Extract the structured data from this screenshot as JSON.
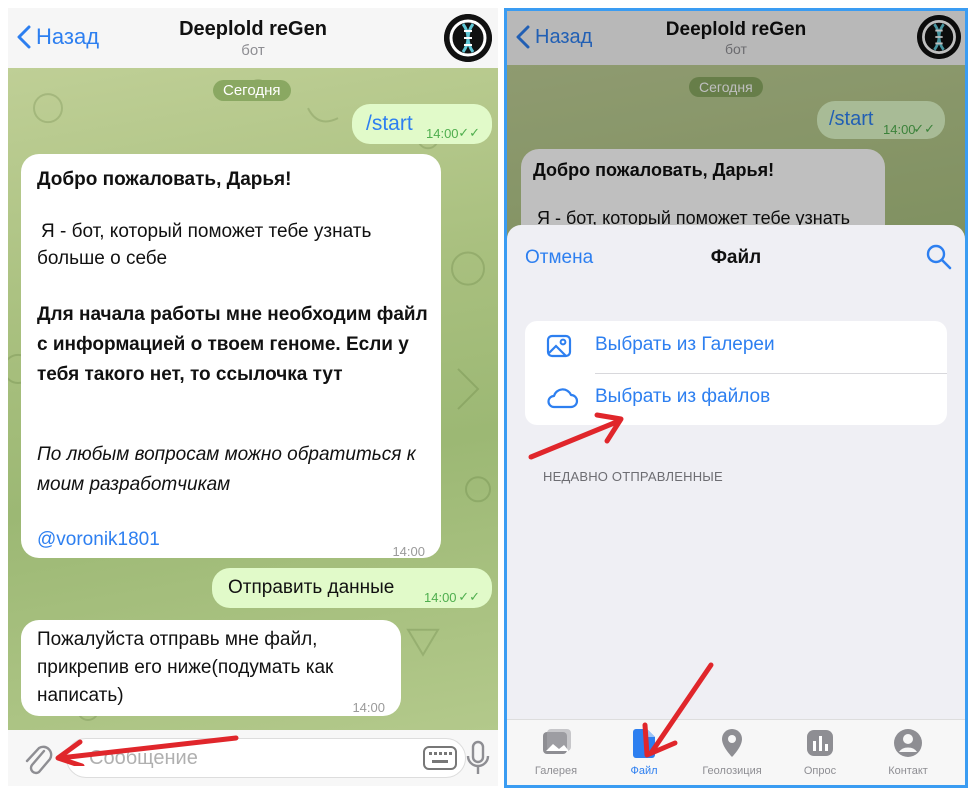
{
  "left": {
    "header": {
      "back_label": "Назад",
      "title": "Deeplold reGen",
      "subtitle": "бот"
    },
    "date_label": "Сегодня",
    "messages": [
      {
        "dir": "out",
        "text": "/start",
        "time": "14:00"
      },
      {
        "dir": "in",
        "greeting": "Добро пожаловать, Дарья!",
        "intro": "Я - бот, который поможет тебе узнать больше о себе",
        "request": "Для начала работы мне необходим файл с информацией о твоем геноме. Если у тебя такого нет, то ссылочка тут",
        "questions": "По любым вопросам можно обратиться к моим разработчикам",
        "handle": "@voronik1801",
        "time": "14:00"
      },
      {
        "dir": "out",
        "text": "Отправить данные",
        "time": "14:00"
      },
      {
        "dir": "in",
        "text": "Пожалуйста отправь мне файл, прикрепив его ниже(подумать как написать)",
        "time": "14:00"
      }
    ],
    "input": {
      "placeholder": "Сообщение"
    }
  },
  "right": {
    "header": {
      "back_label": "Назад",
      "title": "Deeplold reGen",
      "subtitle": "бот"
    },
    "date_label": "Сегодня",
    "messages": [
      {
        "dir": "out",
        "text": "/start",
        "time": "14:00"
      },
      {
        "dir": "in",
        "greeting": "Добро пожаловать, Дарья!",
        "intro": "Я - бот, который поможет тебе узнать"
      }
    ],
    "sheet": {
      "cancel_label": "Отмена",
      "title": "Файл",
      "options": [
        {
          "label": "Выбрать из Галереи",
          "icon": "image-icon"
        },
        {
          "label": "Выбрать из файлов",
          "icon": "cloud-icon"
        }
      ],
      "recent_caption": "НЕДАВНО ОТПРАВЛЕННЫЕ"
    },
    "tabs": [
      {
        "label": "Галерея",
        "icon": "gallery-icon",
        "active": false
      },
      {
        "label": "Файл",
        "icon": "file-icon",
        "active": true
      },
      {
        "label": "Геолозиция",
        "icon": "location-icon",
        "active": false
      },
      {
        "label": "Опрос",
        "icon": "poll-icon",
        "active": false
      },
      {
        "label": "Контакт",
        "icon": "contact-icon",
        "active": false
      }
    ]
  },
  "colors": {
    "accent": "#2d7ff0",
    "annotation_arrow": "#e0262b",
    "frame": "#3a9cf2",
    "outgoing_bubble": "#e1fac9"
  }
}
